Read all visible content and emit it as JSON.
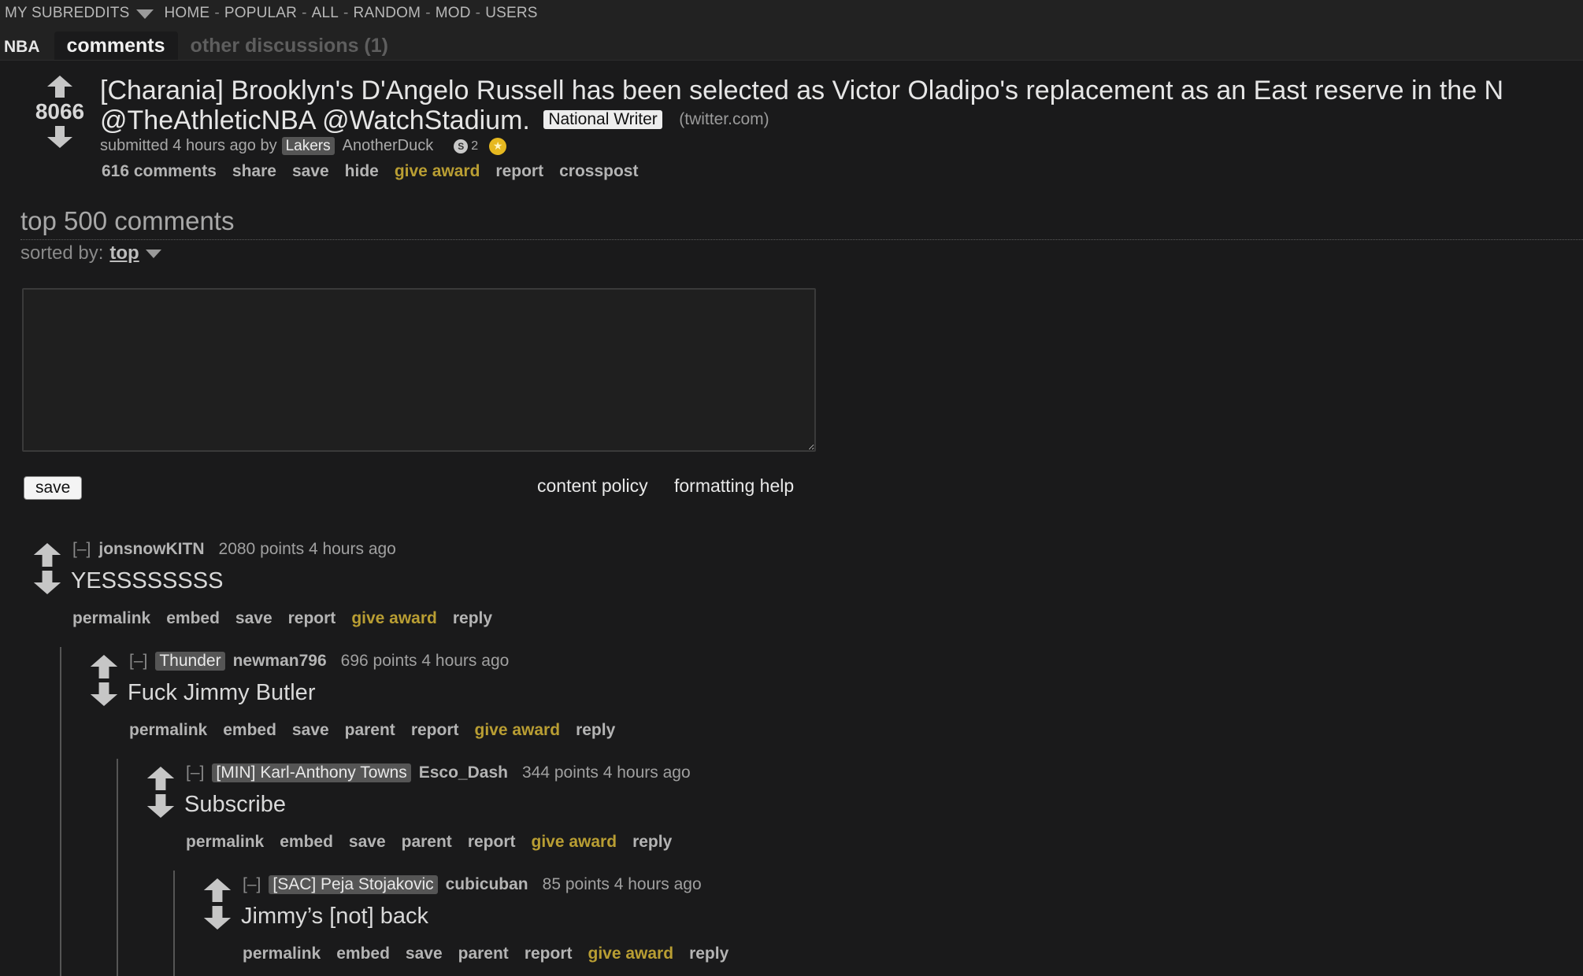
{
  "topbar": {
    "my_subreddits": "MY SUBREDDITS",
    "nav": [
      "HOME",
      "POPULAR",
      "ALL",
      "RANDOM",
      "MOD",
      "USERS"
    ],
    "separator": "-",
    "subreddit": "NBA",
    "tab_active": "comments",
    "tab_other": "other discussions (1)"
  },
  "post": {
    "score": "8066",
    "title_line1": "[Charania] Brooklyn's D'Angelo Russell has been selected as Victor Oladipo's replacement as an East reserve in the N",
    "title_line2": "@TheAthleticNBA @WatchStadium.",
    "flair": "National Writer",
    "domain": "(twitter.com)",
    "submitted": "submitted 4 hours ago by",
    "author_flair": "Lakers",
    "author": "AnotherDuck",
    "silver_count": "2",
    "buttons": [
      "616 comments",
      "share",
      "save",
      "hide",
      "give award",
      "report",
      "crosspost"
    ]
  },
  "comments_area": {
    "title": "top 500 comments",
    "sorted_label": "sorted by:",
    "sorted_value": "top",
    "reply_value": "",
    "save_label": "save",
    "content_policy": "content policy",
    "formatting_help": "formatting help"
  },
  "comments": [
    {
      "expand": "[–]",
      "flair": "",
      "author": "jonsnowKITN",
      "points": "2080 points 4 hours ago",
      "body": "YESSSSSSSS",
      "buttons": [
        "permalink",
        "embed",
        "save",
        "report",
        "give award",
        "reply"
      ]
    },
    {
      "expand": "[–]",
      "flair": "Thunder",
      "author": "newman796",
      "points": "696 points 4 hours ago",
      "body": "Fuck Jimmy Butler",
      "buttons": [
        "permalink",
        "embed",
        "save",
        "parent",
        "report",
        "give award",
        "reply"
      ]
    },
    {
      "expand": "[–]",
      "flair": "[MIN] Karl-Anthony Towns",
      "author": "Esco_Dash",
      "points": "344 points 4 hours ago",
      "body": "Subscribe",
      "buttons": [
        "permalink",
        "embed",
        "save",
        "parent",
        "report",
        "give award",
        "reply"
      ]
    },
    {
      "expand": "[–]",
      "flair": "[SAC] Peja Stojakovic",
      "author": "cubicuban",
      "points": "85 points 4 hours ago",
      "body": "Jimmy’s [not] back",
      "buttons": [
        "permalink",
        "embed",
        "save",
        "parent",
        "report",
        "give award",
        "reply"
      ]
    }
  ],
  "colors": {
    "background": "#1a1a1b",
    "header": "#222222",
    "award_gold": "#b99e33",
    "flair_gray": "#555555"
  },
  "icons": {
    "upvote": "upvote-arrow-icon",
    "downvote": "downvote-arrow-icon",
    "dropdown": "chevron-down-icon",
    "silver": "silver-award-icon",
    "gold": "gold-award-icon"
  }
}
